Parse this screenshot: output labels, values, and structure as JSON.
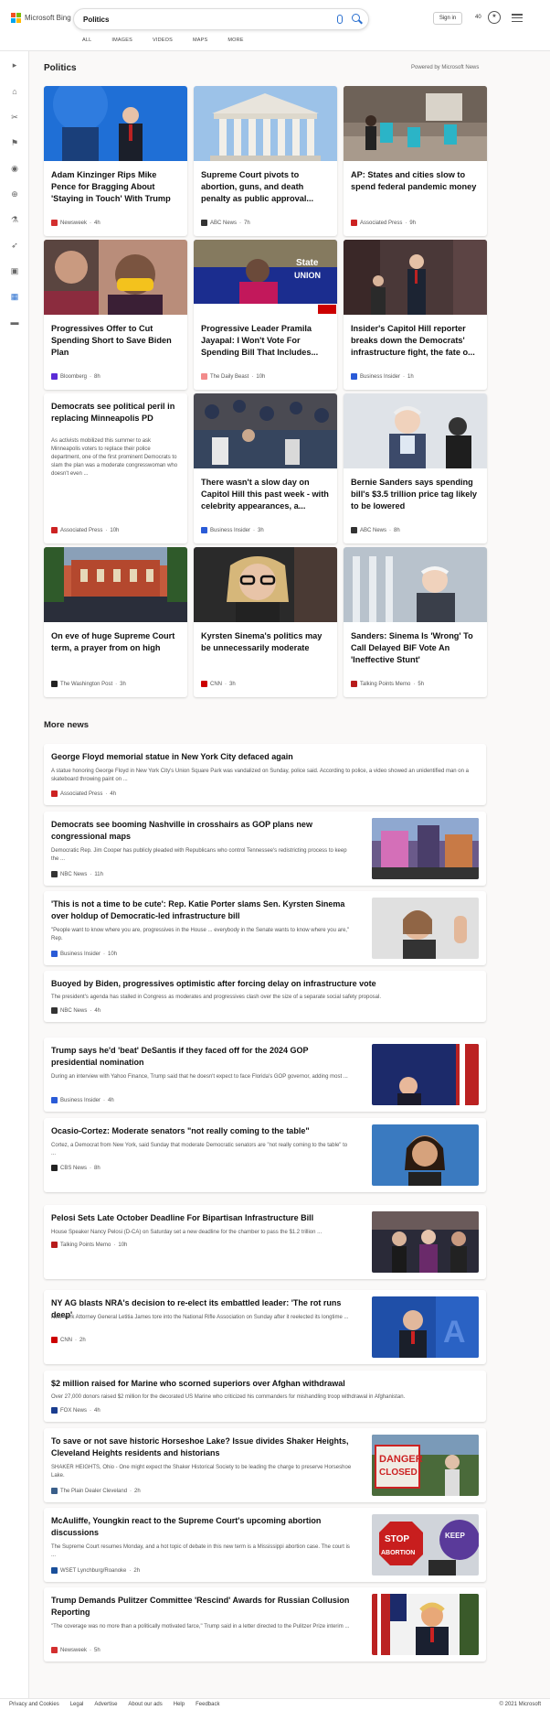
{
  "header": {
    "logo_text": "Microsoft Bing",
    "search_value": "Politics",
    "signin_label": "Sign in",
    "rewards_count": "40",
    "tabs": [
      "ALL",
      "IMAGES",
      "VIDEOS",
      "MAPS",
      "MORE"
    ]
  },
  "colors": {
    "accent": "#2a6fcf",
    "background": "#faf9f8"
  },
  "section": {
    "title": "Politics",
    "powered_by": "Powered by Microsoft News"
  },
  "cards": [
    {
      "title": "Adam Kinzinger Rips Mike Pence for Bragging About 'Staying in Touch' With Trump",
      "source": "Newsweek",
      "time": "4h",
      "fav": "#d32f2f"
    },
    {
      "title": "Supreme Court pivots to abortion, guns, and death penalty as public approval...",
      "source": "ABC News",
      "time": "7h",
      "fav": "#333333"
    },
    {
      "title": "AP: States and cities slow to spend federal pandemic money",
      "source": "Associated Press",
      "time": "9h",
      "fav": "#cc2222"
    },
    {
      "title": "Progressives Offer to Cut Spending Short to Save Biden Plan",
      "source": "Bloomberg",
      "time": "8h",
      "fav": "#5b2bd6"
    },
    {
      "title": "Progressive Leader Pramila Jayapal: I Won't Vote For Spending Bill That Includes...",
      "source": "The Daily Beast",
      "time": "10h",
      "fav": "#f28b8b"
    },
    {
      "title": "Insider's Capitol Hill reporter breaks down the Democrats' infrastructure fight, the fate o...",
      "source": "Business Insider",
      "time": "1h",
      "fav": "#2a5bd7"
    },
    {
      "title": "Democrats see political peril in replacing Minneapolis PD",
      "snippet": "As activists mobilized this summer to ask Minneapolis voters to replace their police department, one of the first prominent Democrats to slam the plan was a moderate congresswoman who doesn't even ...",
      "source": "Associated Press",
      "time": "10h",
      "fav": "#cc2222"
    },
    {
      "title": "There wasn't a slow day on Capitol Hill this past week - with celebrity appearances, a...",
      "source": "Business Insider",
      "time": "3h",
      "fav": "#2a5bd7"
    },
    {
      "title": "Bernie Sanders says spending bill's $3.5 trillion price tag likely to be lowered",
      "source": "ABC News",
      "time": "8h",
      "fav": "#333333"
    },
    {
      "title": "On eve of huge Supreme Court term, a prayer from on high",
      "source": "The Washington Post",
      "time": "3h",
      "fav": "#222222"
    },
    {
      "title": "Kyrsten Sinema's politics may be unnecessarily moderate",
      "source": "CNN",
      "time": "3h",
      "fav": "#cc0000"
    },
    {
      "title": "Sanders: Sinema Is 'Wrong' To Call Delayed BIF Vote An 'Ineffective Stunt'",
      "source": "Talking Points Memo",
      "time": "5h",
      "fav": "#b71c1c"
    }
  ],
  "more_news": {
    "title": "More news",
    "items": [
      {
        "title": "George Floyd memorial statue in New York City defaced again",
        "snippet": "A statue honoring George Floyd in New York City's Union Square Park was vandalized on Sunday, police said. According to police, a video showed an unidentified man on a skateboard throwing paint on ...",
        "source": "Associated Press",
        "time": "4h",
        "fav": "#cc2222"
      },
      {
        "title": "Democrats see booming Nashville in crosshairs as GOP plans new congressional maps",
        "snippet": "Democratic Rep. Jim Cooper has publicly pleaded with Republicans who control Tennessee's redistricting process to keep the ...",
        "source": "NBC News",
        "time": "11h",
        "fav": "#333333"
      },
      {
        "title": "'This is not a time to be cute': Rep. Katie Porter slams Sen. Kyrsten Sinema over holdup of Democratic-led infrastructure bill",
        "snippet": "\"People want to know where you are, progressives in the House ... everybody in the Senate wants to know where you are,\" Rep.",
        "source": "Business Insider",
        "time": "10h",
        "fav": "#2a5bd7"
      },
      {
        "title": "Buoyed by Biden, progressives optimistic after forcing delay on infrastructure vote",
        "snippet": "The president's agenda has stalled in Congress as moderates and progressives clash over the size of a separate social safety proposal.",
        "source": "NBC News",
        "time": "4h",
        "fav": "#333333"
      },
      {
        "title": "Trump says he'd 'beat' DeSantis if they faced off for the 2024 GOP presidential nomination",
        "snippet": "During an interview with Yahoo Finance, Trump said that he doesn't expect to face Florida's GOP governor, adding most ...",
        "source": "Business Insider",
        "time": "4h",
        "fav": "#2a5bd7"
      },
      {
        "title": "Ocasio-Cortez: Moderate senators \"not really coming to the table\"",
        "snippet": "Cortez, a Democrat from New York, said Sunday that moderate Democratic senators are \"not really coming to the table\" to ...",
        "source": "CBS News",
        "time": "8h",
        "fav": "#222222"
      },
      {
        "title": "Pelosi Sets Late October Deadline For Bipartisan Infrastructure Bill",
        "snippet": "House Speaker Nancy Pelosi (D-CA) on Saturday set a new deadline for the chamber to pass the $1.2 trillion ...",
        "source": "Talking Points Memo",
        "time": "10h",
        "fav": "#b71c1c"
      },
      {
        "title": "NY AG blasts NRA's decision to re-elect its embattled leader: 'The rot runs deep'",
        "snippet": "New York Attorney General Letitia James tore into the National Rifle Association on Sunday after it reelected its longtime ...",
        "source": "CNN",
        "time": "2h",
        "fav": "#cc0000"
      },
      {
        "title": "$2 million raised for Marine who scorned superiors over Afghan withdrawal",
        "snippet": "Over 27,000 donors raised $2 million for the decorated US Marine who criticized his commanders for mishandling troop withdrawal in Afghanistan.",
        "source": "FOX News",
        "time": "4h",
        "fav": "#1a3d8f"
      },
      {
        "title": "To save or not save historic Horseshoe Lake? Issue divides Shaker Heights, Cleveland Heights residents and historians",
        "snippet": "SHAKER HEIGHTS, Ohio - One might expect the Shaker Historical Society to be leading the charge to preserve Horseshoe Lake.",
        "source": "The Plain Dealer Cleveland",
        "time": "2h",
        "fav": "#3a5f8a"
      },
      {
        "title": "McAuliffe, Youngkin react to the Supreme Court's upcoming abortion discussions",
        "snippet": "The Supreme Court resumes Monday, and a hot topic of debate in this new term is a Mississippi abortion case. The court is ...",
        "source": "WSET Lynchburg/Roanoke",
        "time": "2h",
        "fav": "#1a4f9a"
      },
      {
        "title": "Trump Demands Pulitzer Committee 'Rescind' Awards for Russian Collusion Reporting",
        "snippet": "\"The coverage was no more than a politically motivated farce,\" Trump said in a letter directed to the Pulitzer Prize interim ...",
        "source": "Newsweek",
        "time": "5h",
        "fav": "#d32f2f"
      }
    ]
  },
  "footer": {
    "links": [
      "Privacy and Cookies",
      "Legal",
      "Advertise",
      "About our ads",
      "Help",
      "Feedback"
    ],
    "copyright": "© 2021 Microsoft"
  }
}
